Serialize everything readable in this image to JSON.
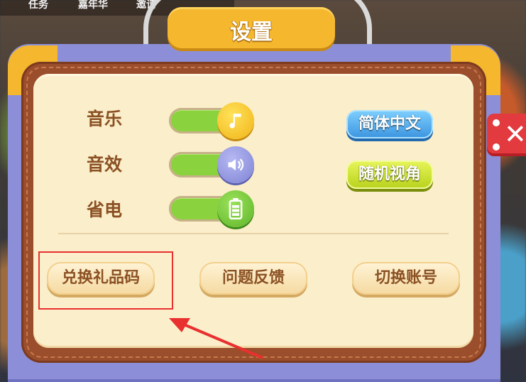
{
  "top_nav": {
    "items": [
      "任务",
      "嘉年华",
      "邀请"
    ]
  },
  "dialog": {
    "title": "设置",
    "settings": [
      {
        "label": "音乐",
        "icon": "music-note-icon",
        "enabled": true
      },
      {
        "label": "音效",
        "icon": "speaker-icon",
        "enabled": true
      },
      {
        "label": "省电",
        "icon": "battery-icon",
        "enabled": true
      }
    ],
    "language_button": "简体中文",
    "camera_button": "随机视角",
    "bottom_buttons": {
      "gift_code": "兑换礼品码",
      "feedback": "问题反馈",
      "switch_account": "切换账号"
    }
  },
  "colors": {
    "title_bar": "#f4b72d",
    "frame": "#8c8fd8",
    "panel": "#fbeecb",
    "text_brown": "#8b5123",
    "highlight": "#e8302f",
    "close_button": "#e23a3f"
  }
}
